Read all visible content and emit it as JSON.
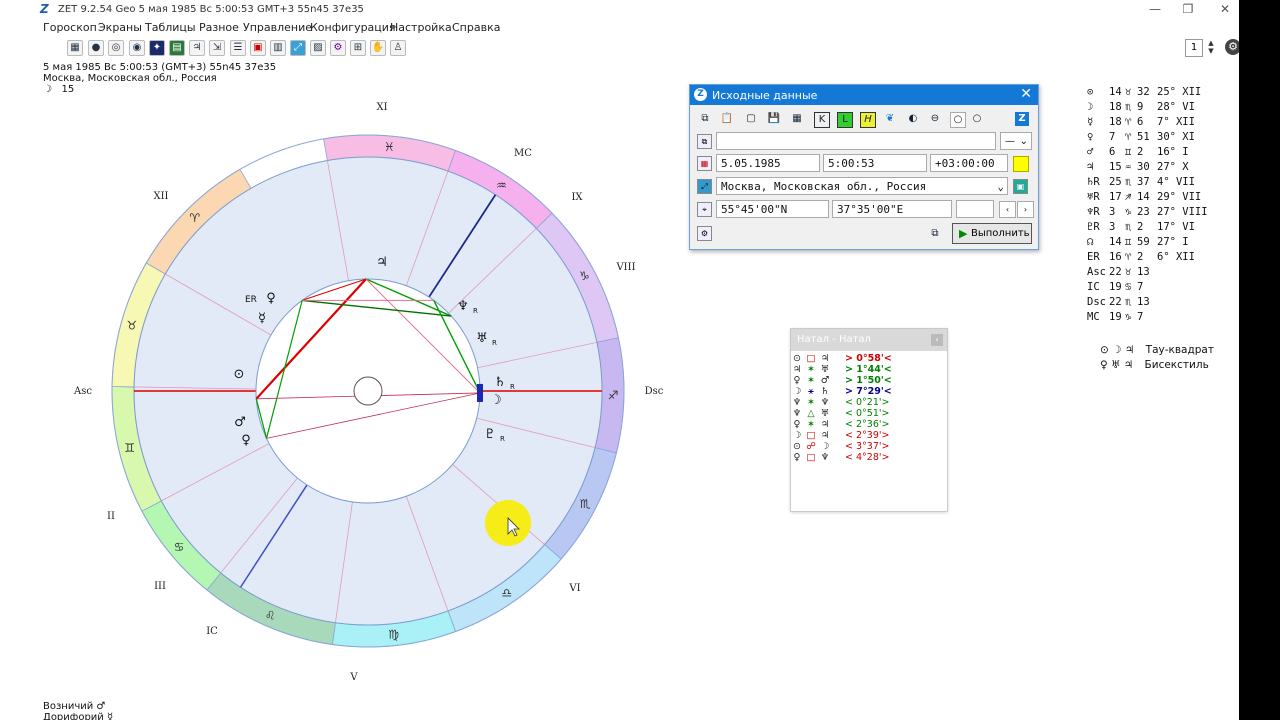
{
  "window": {
    "title": "ZET 9.2.54 Geo    5 мая 1985  Вс    5:00:53 GMT+3 55n45  37e35",
    "min_icon": "minimize-icon",
    "max_icon": "maximize-icon",
    "close_icon": "close-icon"
  },
  "menu": [
    "Гороскоп",
    "Экраны",
    "Таблицы",
    "Разное",
    "Управление",
    "Конфигурация",
    "Настройка",
    "Справка"
  ],
  "toolbar_icons": [
    "grid-icon",
    "globe-icon",
    "chart-icon",
    "stars-icon",
    "table-icon",
    "planet-icon",
    "list-icon",
    "card-icon",
    "arrow-icon",
    "wand-icon",
    "settings-icon",
    "person-icon"
  ],
  "spin_value": "1",
  "header": {
    "line1": "5 мая 1985  Вс   5:00:53 (GMT+3) 55n45  37e35",
    "line2": "Москва, Московская обл., Россия",
    "moon_sym": "☽",
    "moon_val": "15"
  },
  "chart": {
    "houses": [
      "XI",
      "MC",
      "IX",
      "VIII",
      "Dsc",
      "VI",
      "V",
      "IC",
      "III",
      "II",
      "Asc",
      "XII"
    ],
    "signs": [
      "♈",
      "♉",
      "♊",
      "♋",
      "♌",
      "♍",
      "♎",
      "♏",
      "♐",
      "♑",
      "♒",
      "♓"
    ],
    "planets": [
      {
        "sym": "♃",
        "label": ""
      },
      {
        "sym": "♀",
        "label": "ER"
      },
      {
        "sym": "♆",
        "label": "R"
      },
      {
        "sym": "♅",
        "label": "R"
      },
      {
        "sym": "⊙",
        "label": ""
      },
      {
        "sym": "♄",
        "label": "R"
      },
      {
        "sym": "☽",
        "label": ""
      },
      {
        "sym": "♇",
        "label": "R"
      },
      {
        "sym": "♂",
        "label": ""
      },
      {
        "sym": "♀",
        "label": ""
      },
      {
        "sym": "☿",
        "label": ""
      }
    ]
  },
  "footer": {
    "line1": "Возничий  ♂",
    "line2": "Дорифорий  ☿"
  },
  "dialog": {
    "title": "Исходные данные",
    "name_value": "",
    "combo_value": "—",
    "date": "5.05.1985",
    "time": "5:00:53",
    "tz": "+03:00:00",
    "place": "Москва, Московская обл., Россия",
    "lat": "55°45'00\"N",
    "lon": "37°35'00\"E",
    "extra": "",
    "run": "Выполнить",
    "toolbar_labels": [
      "K",
      "L",
      "H"
    ],
    "z_label": "Z",
    "color_accent": "#1479d6"
  },
  "aspects": {
    "title": "Натал - Натал",
    "rows": [
      {
        "a": "⊙",
        "s": "□",
        "b": "♃",
        "v": "> 0°58'<",
        "c": "#d00000",
        "bold": true
      },
      {
        "a": "♃",
        "s": "✶",
        "b": "♅",
        "v": "> 1°44'<",
        "c": "#008000",
        "bold": true
      },
      {
        "a": "♀",
        "s": "✶",
        "b": "♂",
        "v": "> 1°50'<",
        "c": "#008000",
        "bold": true
      },
      {
        "a": "☽",
        "s": "⚹",
        "b": "♄",
        "v": "> 7°29'<",
        "c": "#00008b",
        "bold": true
      },
      {
        "a": "♆",
        "s": "✶",
        "b": "♆",
        "v": "< 0°21'>",
        "c": "#008000",
        "bold": false
      },
      {
        "a": "♆",
        "s": "△",
        "b": "♅",
        "v": "< 0°51'>",
        "c": "#008000",
        "bold": false
      },
      {
        "a": "♀",
        "s": "✶",
        "b": "♃",
        "v": "< 2°36'>",
        "c": "#008000",
        "bold": false
      },
      {
        "a": "☽",
        "s": "□",
        "b": "♃",
        "v": "< 2°39'>",
        "c": "#d00000",
        "bold": false
      },
      {
        "a": "⊙",
        "s": "☍",
        "b": "☽",
        "v": "< 3°37'>",
        "c": "#d00000",
        "bold": false
      },
      {
        "a": "♀",
        "s": "□",
        "b": "♆",
        "v": "< 4°28'>",
        "c": "#d00000",
        "bold": false
      }
    ]
  },
  "positions": [
    {
      "p": "⊙",
      "deg": "14",
      "sign": "♉",
      "min": "32",
      "h": "25° XII"
    },
    {
      "p": "☽",
      "deg": "18",
      "sign": "♏",
      "min": "9",
      "h": "28° VI"
    },
    {
      "p": "☿",
      "deg": "18",
      "sign": "♈",
      "min": "6",
      "h": "7° XII"
    },
    {
      "p": "♀",
      "deg": "7",
      "sign": "♈",
      "min": "51",
      "h": "30° XI"
    },
    {
      "p": "♂",
      "deg": "6",
      "sign": "♊",
      "min": "2",
      "h": "16° I"
    },
    {
      "p": "♃",
      "deg": "15",
      "sign": "♒",
      "min": "30",
      "h": "27° X"
    },
    {
      "p": "♄R",
      "deg": "25",
      "sign": "♏",
      "min": "37",
      "h": "4° VII"
    },
    {
      "p": "♅R",
      "deg": "17",
      "sign": "♐",
      "min": "14",
      "h": "29° VII"
    },
    {
      "p": "♆R",
      "deg": "3",
      "sign": "♑",
      "min": "23",
      "h": "27° VIII"
    },
    {
      "p": "♇R",
      "deg": "3",
      "sign": "♏",
      "min": "2",
      "h": "17° VI"
    },
    {
      "p": "☊",
      "deg": "14",
      "sign": "♊",
      "min": "59",
      "h": "27° I"
    },
    {
      "p": "ER",
      "deg": "16",
      "sign": "♈",
      "min": "2",
      "h": "6° XII"
    },
    {
      "p": "Asc",
      "deg": "22",
      "sign": "♉",
      "min": "13",
      "h": ""
    },
    {
      "p": "IC",
      "deg": "19",
      "sign": "♋",
      "min": "7",
      "h": ""
    },
    {
      "p": "Dsc",
      "deg": "22",
      "sign": "♏",
      "min": "13",
      "h": ""
    },
    {
      "p": "MC",
      "deg": "19",
      "sign": "♑",
      "min": "7",
      "h": ""
    }
  ],
  "configs": [
    {
      "syms": "⊙ ☽ ♃",
      "name": "Тау-квадрат"
    },
    {
      "syms": "♀ ♅ ♃",
      "name": "Бисекстиль"
    }
  ]
}
